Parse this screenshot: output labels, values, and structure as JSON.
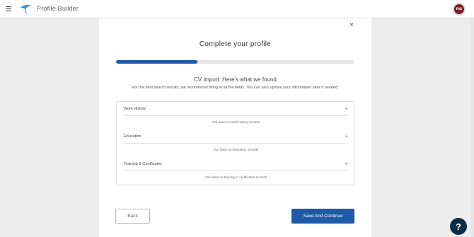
{
  "header": {
    "app_title": "Profile Builder",
    "avatar_initials": "mc"
  },
  "dialog": {
    "close_glyph": "×",
    "title": "Complete your profile",
    "progress_fraction": 0.34,
    "subtitle": "CV import: Here's what we found",
    "description": "For the best search results, we recommend filling in all the fields. You can also update your information later if needed.",
    "sections": [
      {
        "title": "Work History",
        "empty_text": "You have no work history records",
        "add_glyph": "+"
      },
      {
        "title": "Education",
        "empty_text": "You have no education records",
        "add_glyph": "+"
      },
      {
        "title": "Training & Certificates",
        "empty_text": "You have no training or certificates records",
        "add_glyph": "+"
      }
    ],
    "back_label": "Back",
    "continue_label": "Save And Continue"
  },
  "help": {
    "glyph": "?"
  },
  "colors": {
    "primary": "#1f5aa6",
    "help_bg": "#0c2d48",
    "avatar_bg": "#7a1f2b"
  }
}
